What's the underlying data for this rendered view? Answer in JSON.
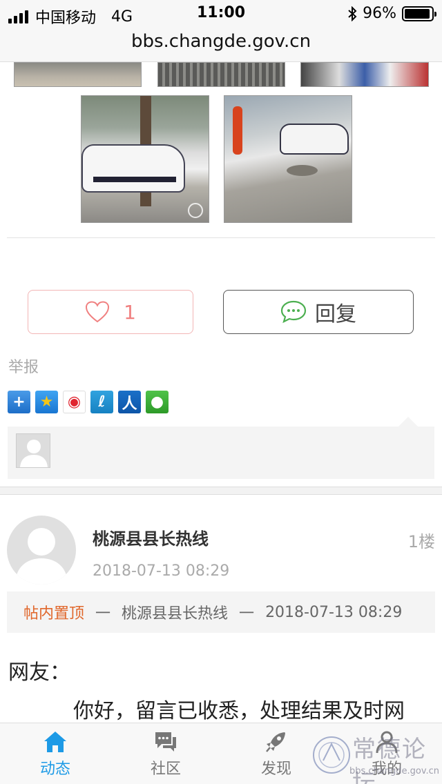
{
  "status_bar": {
    "carrier": "中国移动",
    "network": "4G",
    "time": "11:00",
    "battery_percent": "96%",
    "battery_level": 0.96
  },
  "url_bar": {
    "url": "bbs.changde.gov.cn"
  },
  "post": {
    "like_count": "1",
    "reply_label": "回复",
    "report_label": "举报",
    "share_icons": [
      "plus-icon",
      "qzone-icon",
      "weibo-icon",
      "tencent-weibo-icon",
      "renren-icon",
      "wechat-icon"
    ]
  },
  "reply": {
    "author": "桃源县县长热线",
    "floor": "1楼",
    "date": "2018-07-13 08:29",
    "pin_label": "帖内置顶",
    "pin_sep": "一",
    "pin_author": "桃源县县长热线",
    "pin_date": "2018-07-13 08:29",
    "greeting": "网友：",
    "body": "你好，留言已收悉，处理结果及时网"
  },
  "tab_bar": {
    "tabs": [
      {
        "label": "动态",
        "icon": "home-icon",
        "active": true
      },
      {
        "label": "社区",
        "icon": "chat-bubbles-icon",
        "active": false
      },
      {
        "label": "发现",
        "icon": "rocket-icon",
        "active": false
      },
      {
        "label": "我的",
        "icon": "user-icon",
        "active": false
      }
    ]
  },
  "watermark": {
    "text": "常德论坛",
    "url": "bbs.changde.gov.cn"
  },
  "colors": {
    "accent": "#1d9ae6",
    "like": "#f08080",
    "pin": "#e0662a"
  }
}
